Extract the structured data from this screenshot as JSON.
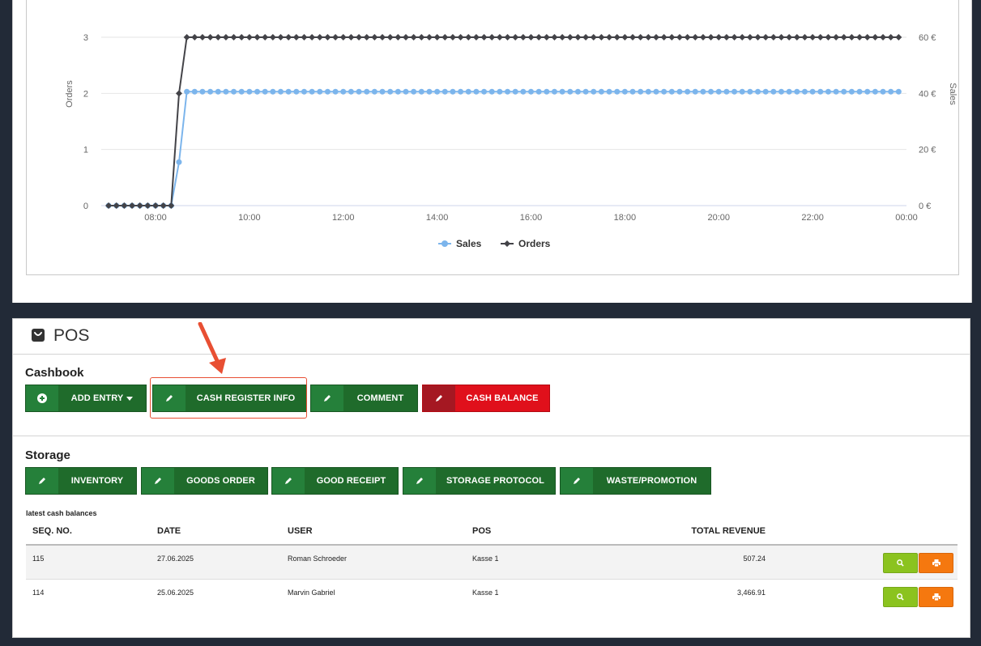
{
  "chart_data": {
    "type": "line",
    "x_ticks": [
      "08:00",
      "10:00",
      "12:00",
      "14:00",
      "16:00",
      "18:00",
      "20:00",
      "22:00",
      "00:00"
    ],
    "y_left": {
      "label": "Orders",
      "ticks": [
        "0",
        "1",
        "2",
        "3"
      ],
      "range": [
        0,
        3
      ]
    },
    "y_right": {
      "label": "Sales",
      "ticks": [
        "0 €",
        "20 €",
        "40 €",
        "60 €"
      ],
      "range": [
        0,
        60
      ]
    },
    "series": [
      {
        "name": "Sales",
        "color": "#7cb5ec",
        "marker": "circle",
        "points": [
          [
            "07:00",
            0
          ],
          [
            "07:10",
            0
          ],
          [
            "07:20",
            0
          ],
          [
            "07:30",
            0
          ],
          [
            "07:40",
            0
          ],
          [
            "07:50",
            0
          ],
          [
            "08:00",
            0
          ],
          [
            "08:10",
            0
          ],
          [
            "08:20",
            0
          ],
          [
            "08:30",
            15.5
          ],
          [
            "08:40",
            40.6
          ],
          [
            "08:50",
            40.6
          ],
          [
            "09:00",
            40.6
          ],
          [
            "23:50",
            40.6
          ]
        ],
        "flat_after": "08:40",
        "flat_value": 40.6
      },
      {
        "name": "Orders",
        "color": "#434348",
        "marker": "diamond",
        "points": [
          [
            "07:00",
            0
          ],
          [
            "07:10",
            0
          ],
          [
            "07:20",
            0
          ],
          [
            "07:30",
            0
          ],
          [
            "07:40",
            0
          ],
          [
            "07:50",
            0
          ],
          [
            "08:00",
            0
          ],
          [
            "08:10",
            0
          ],
          [
            "08:20",
            0
          ],
          [
            "08:30",
            2
          ],
          [
            "08:40",
            3
          ],
          [
            "08:50",
            3
          ],
          [
            "09:00",
            3
          ],
          [
            "23:50",
            3
          ]
        ],
        "flat_after": "08:40",
        "flat_value": 3
      }
    ],
    "legend": [
      "Sales",
      "Orders"
    ],
    "legend_position": "bottom-center"
  },
  "pos": {
    "title": "POS",
    "cashbook": {
      "title": "Cashbook",
      "buttons": [
        {
          "label": "ADD ENTRY",
          "icon": "plus-circle-icon"
        },
        {
          "label": "CASH REGISTER INFO",
          "icon": "pencil-icon"
        },
        {
          "label": "COMMENT",
          "icon": "pencil-icon"
        },
        {
          "label": "CASH BALANCE",
          "icon": "pencil-icon",
          "color": "#e0101b"
        }
      ]
    },
    "storage": {
      "title": "Storage",
      "buttons": [
        {
          "label": "INVENTORY",
          "icon": "pencil-icon"
        },
        {
          "label": "GOODS ORDER",
          "icon": "pencil-icon"
        },
        {
          "label": "GOOD RECEIPT",
          "icon": "pencil-icon"
        },
        {
          "label": "STORAGE PROTOCOL",
          "icon": "pencil-icon"
        },
        {
          "label": "WASTE/PROMOTION",
          "icon": "pencil-icon"
        }
      ]
    },
    "latest": {
      "caption": "latest cash balances",
      "headers": [
        "SEQ. NO.",
        "DATE",
        "USER",
        "POS",
        "TOTAL REVENUE"
      ],
      "rows": [
        {
          "seq": "115",
          "date": "27.06.2025",
          "user": "Roman Schroeder",
          "pos": "Kasse 1",
          "revenue": "507.24"
        },
        {
          "seq": "114",
          "date": "25.06.2025",
          "user": "Marvin Gabriel",
          "pos": "Kasse 1",
          "revenue": "3,466.91"
        }
      ]
    }
  },
  "colors": {
    "primary_button": "#1f6b2b",
    "danger_button": "#e0101b",
    "view_button": "#8bc31f",
    "print_button": "#f5780f",
    "annotation": "#e84f33"
  }
}
